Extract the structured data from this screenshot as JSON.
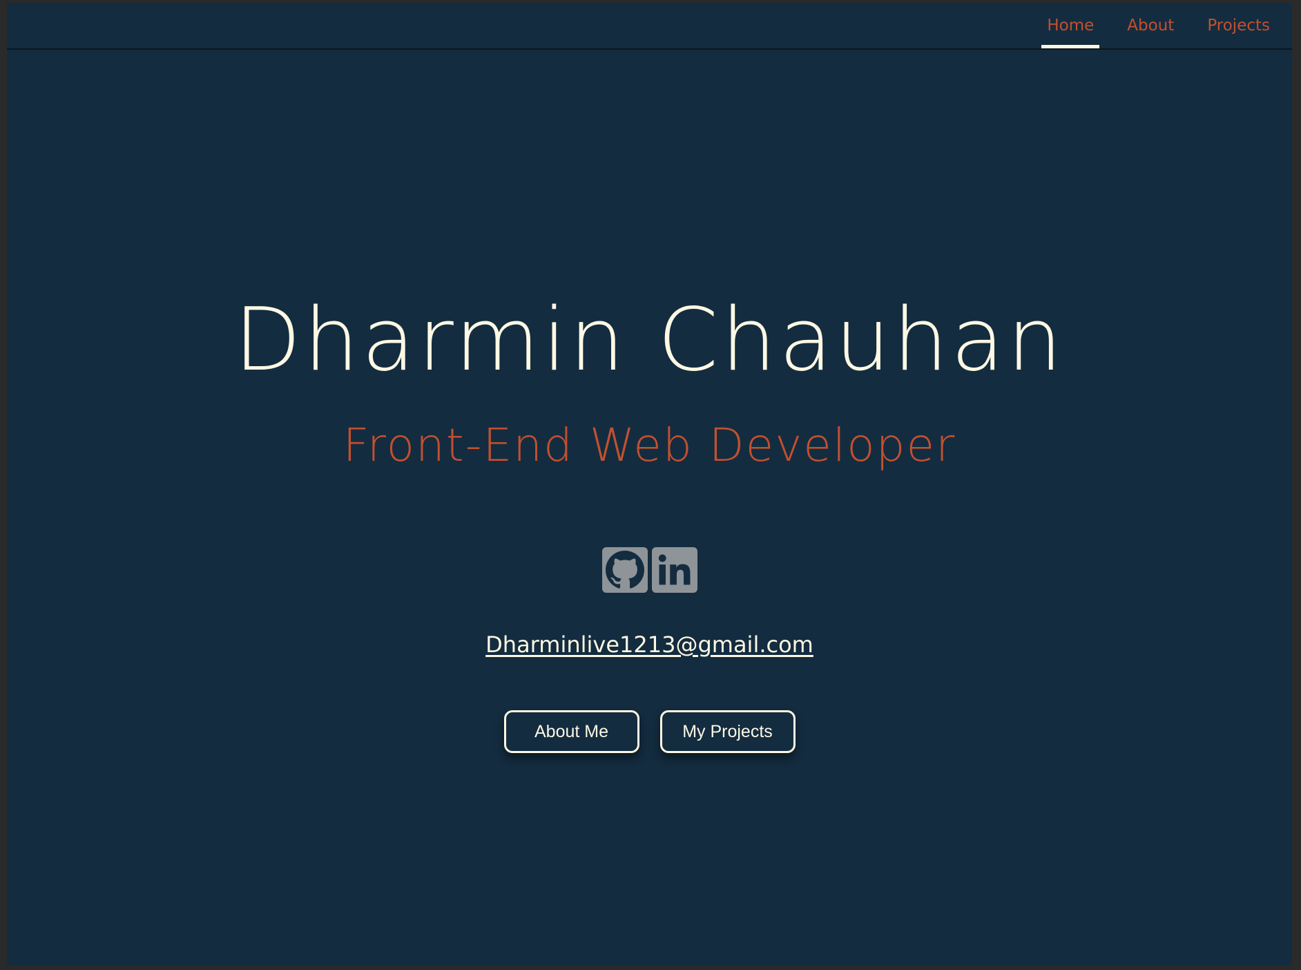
{
  "colors": {
    "background": "#142c40",
    "accent": "#c2502f",
    "text": "#fdf8e3",
    "icon_bg": "#8f9498"
  },
  "nav": {
    "items": [
      {
        "label": "Home",
        "active": true
      },
      {
        "label": "About",
        "active": false
      },
      {
        "label": "Projects",
        "active": false
      }
    ]
  },
  "hero": {
    "name": "Dharmin Chauhan",
    "role": "Front-End Web Developer"
  },
  "social": {
    "icons": [
      "github-icon",
      "linkedin-icon"
    ]
  },
  "contact": {
    "email": "Dharminlive1213@gmail.com"
  },
  "buttons": {
    "about": "About Me",
    "projects": "My Projects"
  }
}
